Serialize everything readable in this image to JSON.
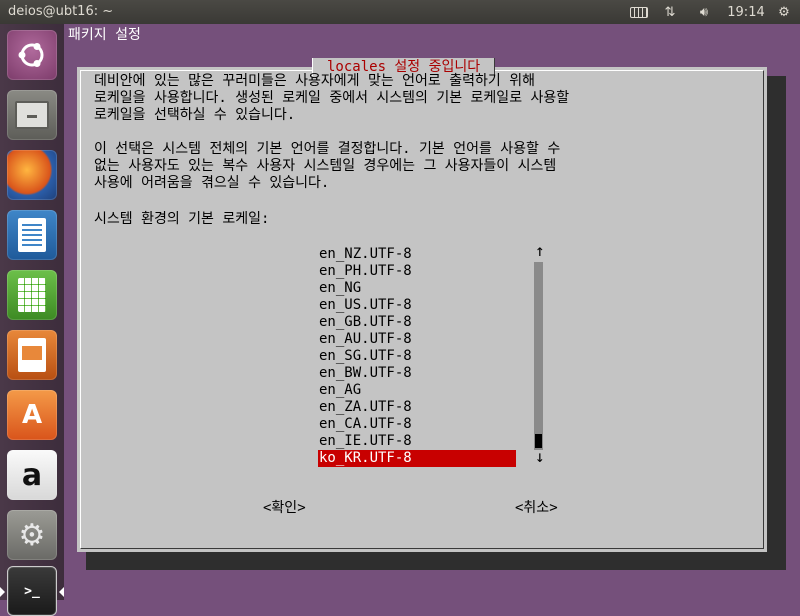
{
  "topbar": {
    "window_title": "deios@ubt16: ~",
    "clock": "19:14"
  },
  "launcher": {
    "items": [
      {
        "name": "ubuntu-dash",
        "icon": "ubuntu-logo-icon"
      },
      {
        "name": "files",
        "icon": "files-drawer-icon"
      },
      {
        "name": "firefox",
        "icon": "firefox-icon"
      },
      {
        "name": "libreoffice-writer",
        "icon": "writer-document-icon"
      },
      {
        "name": "libreoffice-calc",
        "icon": "calc-spreadsheet-icon"
      },
      {
        "name": "libreoffice-impress",
        "icon": "impress-presentation-icon"
      },
      {
        "name": "ubuntu-software",
        "icon": "software-center-icon"
      },
      {
        "name": "amazon",
        "icon": "amazon-icon"
      },
      {
        "name": "system-settings",
        "icon": "settings-gear-icon"
      },
      {
        "name": "terminal",
        "icon": "terminal-icon",
        "glyph": ">_"
      }
    ],
    "amazon_glyph": "a",
    "software_glyph": "A"
  },
  "terminal": {
    "backtitle": "패키지 설정"
  },
  "dialog": {
    "title": "locales 설정 중입니다",
    "paragraph1": "데비안에 있는 많은 꾸러미들은 사용자에게 맞는 언어로 출력하기 위해\n로케일을 사용합니다. 생성된 로케일 중에서 시스템의 기본 로케일로 사용할\n로케일을 선택하실 수 있습니다.",
    "paragraph2": "이 선택은 시스템 전체의 기본 언어를 결정합니다. 기본 언어를 사용할 수\n없는 사용자도 있는 복수 사용자 시스템일 경우에는 그 사용자들이 시스템\n사용에 어려움을 겪으실 수 있습니다.",
    "prompt_label": "시스템 환경의 기본 로케일:",
    "locales": [
      "en_NZ.UTF-8",
      "en_PH.UTF-8",
      "en_NG",
      "en_US.UTF-8",
      "en_GB.UTF-8",
      "en_AU.UTF-8",
      "en_SG.UTF-8",
      "en_BW.UTF-8",
      "en_AG",
      "en_ZA.UTF-8",
      "en_CA.UTF-8",
      "en_IE.UTF-8",
      "ko_KR.UTF-8"
    ],
    "selected_locale": "ko_KR.UTF-8",
    "scroll_up": "↑",
    "scroll_down": "↓",
    "ok_label": "<확인>",
    "cancel_label": "<취소>"
  },
  "colors": {
    "desktop_purple": "#75507b",
    "dialog_gray": "#c4c4c4",
    "title_red": "#aa0000",
    "selection_red": "#c80000"
  }
}
